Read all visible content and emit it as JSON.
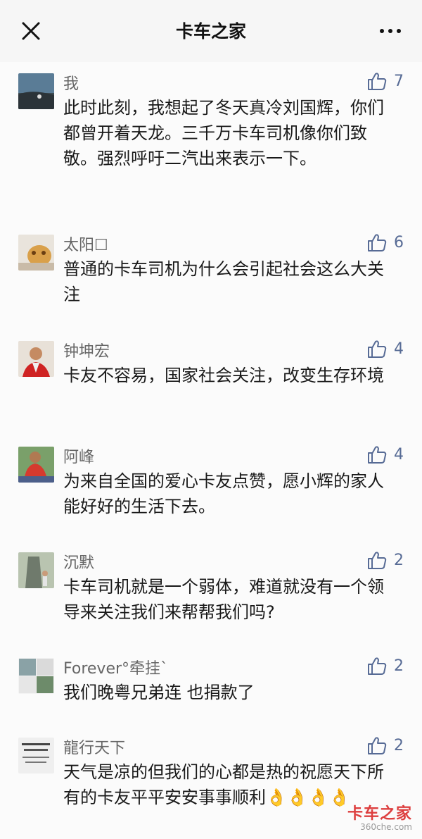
{
  "header": {
    "title": "卡车之家",
    "close_icon": "close-icon",
    "more_icon": "more-dots-icon"
  },
  "comments": [
    {
      "name": "我",
      "likes": "7",
      "text": "此时此刻，我想起了冬天真冷刘国辉，你们都曾开着天龙。三千万卡车司机像你们致敬。强烈呼吁二汽出来表示一下。"
    },
    {
      "name": "太阳☐",
      "likes": "6",
      "text": "普通的卡车司机为什么会引起社会这么大关注"
    },
    {
      "name": "钟坤宏",
      "likes": "4",
      "text": "卡友不容易，国家社会关注，改变生存环境"
    },
    {
      "name": "阿峰",
      "likes": "4",
      "text": "为来自全国的爱心卡友点赞，愿小辉的家人能好好的生活下去。"
    },
    {
      "name": "沉默",
      "likes": "2",
      "text": "卡车司机就是一个弱体，难道就没有一个领导来关注我们来帮帮我们吗?"
    },
    {
      "name": "Forever°牵挂`",
      "likes": "2",
      "text": "我们晚粤兄弟连 也捐款了"
    },
    {
      "name": "龍行天下",
      "likes": "2",
      "text": "天气是凉的但我们的心都是热的祝愿天下所有的卡友平平安安事事顺利👌👌👌👌"
    }
  ],
  "watermark": {
    "brand": "卡车之家",
    "sub": "360che.com"
  },
  "colors": {
    "like_blue": "#576b95",
    "watermark_red": "#d81e1e"
  }
}
